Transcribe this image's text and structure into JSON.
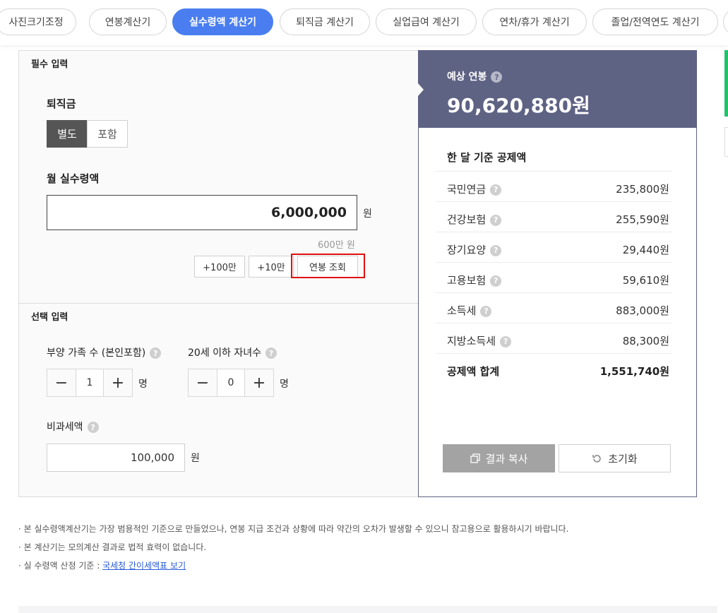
{
  "tabs": [
    {
      "label": "사진크기조정",
      "active": false
    },
    {
      "label": "연봉계산기",
      "active": false
    },
    {
      "label": "실수령액 계산기",
      "active": true
    },
    {
      "label": "퇴직금 계산기",
      "active": false
    },
    {
      "label": "실업급여 계산기",
      "active": false
    },
    {
      "label": "연차/휴가 계산기",
      "active": false
    },
    {
      "label": "졸업/전역연도 계산기",
      "active": false
    }
  ],
  "required": {
    "section_title": "필수 입력",
    "severance_label": "퇴직금",
    "severance_options": [
      "별도",
      "포함"
    ],
    "severance_selected": "별도",
    "monthly_label": "월 실수령액",
    "monthly_value": "6,000,000",
    "monthly_unit": "원",
    "monthly_hint": "600만 원",
    "buttons": {
      "plus100": "+100만",
      "plus10": "+10만",
      "lookup": "연봉 조회"
    }
  },
  "optional": {
    "section_title": "선택 입력",
    "dependents_label": "부양 가족 수 (본인포함)",
    "dependents_value": "1",
    "children_label": "20세 이하 자녀수",
    "children_value": "0",
    "count_unit": "명",
    "nontax_label": "비과세액",
    "nontax_value": "100,000",
    "nontax_unit": "원"
  },
  "result": {
    "annual_label": "예상 연봉",
    "annual_value": "90,620,880원",
    "deduction_title": "한 달 기준 공제액",
    "deductions": [
      {
        "name": "국민연금",
        "amount": "235,800원"
      },
      {
        "name": "건강보험",
        "amount": "255,590원"
      },
      {
        "name": "장기요양",
        "amount": "29,440원"
      },
      {
        "name": "고용보험",
        "amount": "59,610원"
      },
      {
        "name": "소득세",
        "amount": "883,000원"
      },
      {
        "name": "지방소득세",
        "amount": "88,300원"
      }
    ],
    "total": {
      "name": "공제액 합계",
      "amount": "1,551,740원"
    },
    "copy_button": "결과 복사",
    "reset_button": "초기화"
  },
  "notes": {
    "line1": "· 본 실수령액계산기는 가장 범용적인 기준으로 만들었으나, 연봉 지급 조건과 상황에 따라 약간의 오차가 발생할 수 있으니 참고용으로 활용하시기 바랍니다.",
    "line2": "· 본 계산기는 모의계산 결과로 법적 효력이 없습니다.",
    "line3_prefix": "· 실 수령액 산정 기준 : ",
    "line3_link": "국세청 간이세액표 보기"
  },
  "colors": {
    "accent": "#4a7ef0",
    "result_header": "#5e6283",
    "highlight": "#e01010"
  }
}
